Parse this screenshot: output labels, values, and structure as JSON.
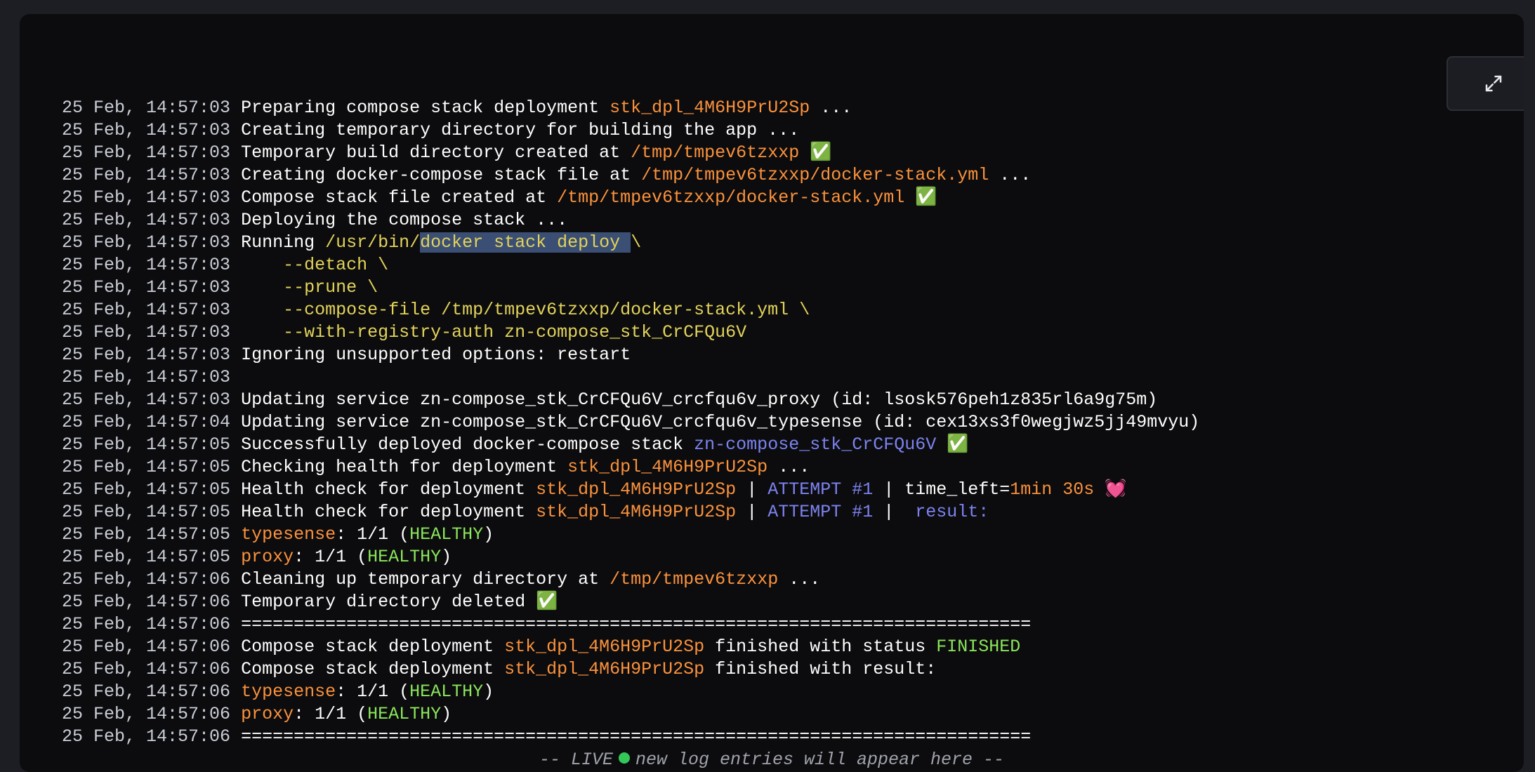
{
  "toolbar": {
    "fullscreen_icon": "expand-icon"
  },
  "logs": [
    {
      "ts": "25 Feb, 14:57:03",
      "segments": [
        {
          "t": "Preparing compose stack deployment "
        },
        {
          "t": "stk_dpl_4M6H9PrU2Sp",
          "c": "orange"
        },
        {
          "t": " ..."
        }
      ]
    },
    {
      "ts": "25 Feb, 14:57:03",
      "segments": [
        {
          "t": "Creating temporary directory for building the app ..."
        }
      ]
    },
    {
      "ts": "25 Feb, 14:57:03",
      "segments": [
        {
          "t": "Temporary build directory created at "
        },
        {
          "t": "/tmp/tmpev6tzxxp",
          "c": "orange"
        },
        {
          "t": " ✅"
        }
      ]
    },
    {
      "ts": "25 Feb, 14:57:03",
      "segments": [
        {
          "t": "Creating docker-compose stack file at "
        },
        {
          "t": "/tmp/tmpev6tzxxp/docker-stack.yml",
          "c": "orange"
        },
        {
          "t": " ..."
        }
      ]
    },
    {
      "ts": "25 Feb, 14:57:03",
      "segments": [
        {
          "t": "Compose stack file created at "
        },
        {
          "t": "/tmp/tmpev6tzxxp/docker-stack.yml",
          "c": "orange"
        },
        {
          "t": " ✅"
        }
      ]
    },
    {
      "ts": "25 Feb, 14:57:03",
      "segments": [
        {
          "t": "Deploying the compose stack ..."
        }
      ]
    },
    {
      "ts": "25 Feb, 14:57:03",
      "segments": [
        {
          "t": "Running "
        },
        {
          "t": "/usr/bin/",
          "c": "yellow"
        },
        {
          "t": "docker stack deploy ",
          "c": "yellow",
          "sel": true
        },
        {
          "t": "\\",
          "c": "yellow"
        }
      ]
    },
    {
      "ts": "25 Feb, 14:57:03",
      "segments": [
        {
          "t": "    --detach \\",
          "c": "yellow"
        }
      ]
    },
    {
      "ts": "25 Feb, 14:57:03",
      "segments": [
        {
          "t": "    --prune \\",
          "c": "yellow"
        }
      ]
    },
    {
      "ts": "25 Feb, 14:57:03",
      "segments": [
        {
          "t": "    --compose-file /tmp/tmpev6tzxxp/docker-stack.yml \\",
          "c": "yellow"
        }
      ]
    },
    {
      "ts": "25 Feb, 14:57:03",
      "segments": [
        {
          "t": "    --with-registry-auth zn-compose_stk_CrCFQu6V",
          "c": "yellow"
        }
      ]
    },
    {
      "ts": "25 Feb, 14:57:03",
      "segments": [
        {
          "t": "Ignoring unsupported options: restart"
        }
      ]
    },
    {
      "ts": "25 Feb, 14:57:03",
      "segments": []
    },
    {
      "ts": "25 Feb, 14:57:03",
      "segments": [
        {
          "t": "Updating service zn-compose_stk_CrCFQu6V_crcfqu6v_proxy (id: lsosk576peh1z835rl6a9g75m)"
        }
      ]
    },
    {
      "ts": "25 Feb, 14:57:04",
      "segments": [
        {
          "t": "Updating service zn-compose_stk_CrCFQu6V_crcfqu6v_typesense (id: cex13xs3f0wegjwz5jj49mvyu)"
        }
      ]
    },
    {
      "ts": "25 Feb, 14:57:05",
      "segments": [
        {
          "t": "Successfully deployed docker-compose stack "
        },
        {
          "t": "zn-compose_stk_CrCFQu6V",
          "c": "purple"
        },
        {
          "t": " ✅"
        }
      ]
    },
    {
      "ts": "25 Feb, 14:57:05",
      "segments": [
        {
          "t": "Checking health for deployment "
        },
        {
          "t": "stk_dpl_4M6H9PrU2Sp",
          "c": "orange"
        },
        {
          "t": " ..."
        }
      ]
    },
    {
      "ts": "25 Feb, 14:57:05",
      "segments": [
        {
          "t": "Health check for deployment "
        },
        {
          "t": "stk_dpl_4M6H9PrU2Sp",
          "c": "orange"
        },
        {
          "t": " | "
        },
        {
          "t": "ATTEMPT #1",
          "c": "purple"
        },
        {
          "t": " | time_left="
        },
        {
          "t": "1min 30s",
          "c": "orange"
        },
        {
          "t": " 💓"
        }
      ]
    },
    {
      "ts": "25 Feb, 14:57:05",
      "segments": [
        {
          "t": "Health check for deployment "
        },
        {
          "t": "stk_dpl_4M6H9PrU2Sp",
          "c": "orange"
        },
        {
          "t": " | "
        },
        {
          "t": "ATTEMPT #1",
          "c": "purple"
        },
        {
          "t": " |  "
        },
        {
          "t": "result:",
          "c": "purple"
        }
      ]
    },
    {
      "ts": "25 Feb, 14:57:05",
      "segments": [
        {
          "t": "typesense",
          "c": "orange"
        },
        {
          "t": ": 1/1 ("
        },
        {
          "t": "HEALTHY",
          "c": "green"
        },
        {
          "t": ")"
        }
      ]
    },
    {
      "ts": "25 Feb, 14:57:05",
      "segments": [
        {
          "t": "proxy",
          "c": "orange"
        },
        {
          "t": ": 1/1 ("
        },
        {
          "t": "HEALTHY",
          "c": "green"
        },
        {
          "t": ")"
        }
      ]
    },
    {
      "ts": "25 Feb, 14:57:06",
      "segments": [
        {
          "t": "Cleaning up temporary directory at "
        },
        {
          "t": "/tmp/tmpev6tzxxp",
          "c": "orange"
        },
        {
          "t": " ..."
        }
      ]
    },
    {
      "ts": "25 Feb, 14:57:06",
      "segments": [
        {
          "t": "Temporary directory deleted ✅"
        }
      ]
    },
    {
      "ts": "25 Feb, 14:57:06",
      "segments": [
        {
          "t": "==========================================================================="
        }
      ]
    },
    {
      "ts": "25 Feb, 14:57:06",
      "segments": [
        {
          "t": "Compose stack deployment "
        },
        {
          "t": "stk_dpl_4M6H9PrU2Sp",
          "c": "orange"
        },
        {
          "t": " finished with status "
        },
        {
          "t": "FINISHED",
          "c": "green"
        }
      ]
    },
    {
      "ts": "25 Feb, 14:57:06",
      "segments": [
        {
          "t": "Compose stack deployment "
        },
        {
          "t": "stk_dpl_4M6H9PrU2Sp",
          "c": "orange"
        },
        {
          "t": " finished with result:"
        }
      ]
    },
    {
      "ts": "25 Feb, 14:57:06",
      "segments": [
        {
          "t": "typesense",
          "c": "orange"
        },
        {
          "t": ": 1/1 ("
        },
        {
          "t": "HEALTHY",
          "c": "green"
        },
        {
          "t": ")"
        }
      ]
    },
    {
      "ts": "25 Feb, 14:57:06",
      "segments": [
        {
          "t": "proxy",
          "c": "orange"
        },
        {
          "t": ": 1/1 ("
        },
        {
          "t": "HEALTHY",
          "c": "green"
        },
        {
          "t": ")"
        }
      ]
    },
    {
      "ts": "25 Feb, 14:57:06",
      "segments": [
        {
          "t": "==========================================================================="
        }
      ]
    }
  ],
  "live": {
    "prefix": "-- LIVE",
    "suffix": "new log entries will appear here --",
    "dot_color": "#34c759"
  },
  "colors": {
    "background": "#0c0c0e",
    "orange": "#fb923c",
    "yellow": "#e3d35a",
    "green": "#8ae65a",
    "purple": "#7c83f0",
    "selection": "#3b4f74"
  }
}
